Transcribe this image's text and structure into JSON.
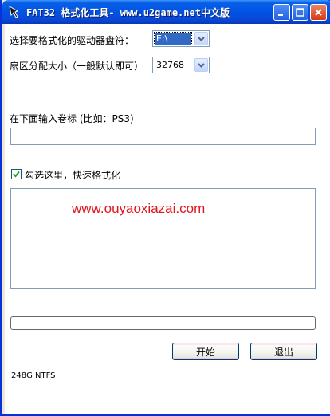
{
  "window": {
    "title": "FAT32 格式化工具- www.u2game.net中文版"
  },
  "drive": {
    "label": "选择要格式化的驱动器盘符：",
    "value": "E:\\"
  },
  "cluster": {
    "label": "扇区分配大小（一般默认即可）",
    "value": "32768"
  },
  "volume_label": {
    "label": "在下面输入卷标 (比如：PS3)",
    "value": ""
  },
  "quick_format": {
    "label": "勾选这里，快速格式化",
    "checked": true
  },
  "log": {
    "watermark": "www.ouyaoxiazai.com"
  },
  "progress": {
    "value": 0
  },
  "buttons": {
    "start": "开始",
    "exit": "退出"
  },
  "status": {
    "text": "248G NTFS"
  }
}
